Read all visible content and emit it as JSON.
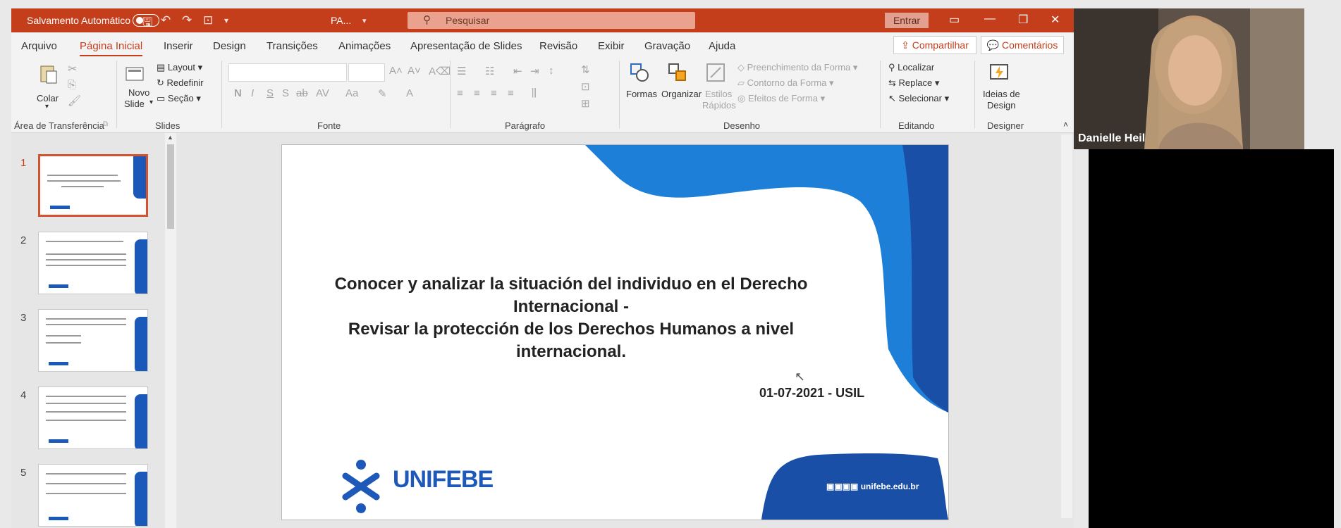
{
  "titlebar": {
    "autosave_label": "Salvamento Automático",
    "doc_name": "PA...",
    "search_placeholder": "Pesquisar",
    "signin_label": "Entrar"
  },
  "tabs": [
    "Arquivo",
    "Página Inicial",
    "Inserir",
    "Design",
    "Transições",
    "Animações",
    "Apresentação de Slides",
    "Revisão",
    "Exibir",
    "Gravação",
    "Ajuda"
  ],
  "active_tab": "Página Inicial",
  "share_label": "Compartilhar",
  "comments_label": "Comentários",
  "ribbon": {
    "paste": "Colar",
    "layout": "Layout",
    "reset": "Redefinir",
    "new_slide_1": "Novo",
    "new_slide_2": "Slide",
    "section": "Seção",
    "shapes": "Formas",
    "arrange": "Organizar",
    "styles_1": "Estilos",
    "styles_2": "Rápidos",
    "fill": "Preenchimento da Forma",
    "outline": "Contorno da Forma",
    "effects": "Efeitos de Forma",
    "find": "Localizar",
    "replace": "Replace",
    "select": "Selecionar",
    "ideas_1": "Ideias de",
    "ideas_2": "Design",
    "groups": {
      "clipboard": "Área de Transferência",
      "slides": "Slides",
      "font": "Fonte",
      "paragraph": "Parágrafo",
      "drawing": "Desenho",
      "editing": "Editando",
      "designer": "Designer"
    }
  },
  "thumbnails": [
    "1",
    "2",
    "3",
    "4",
    "5"
  ],
  "slide": {
    "title_line1": "Conocer y analizar la situación del individuo en el Derecho",
    "title_line2": "Internacional -",
    "title_line3": "Revisar la protección de los Derechos Humanos a nivel",
    "title_line4": "internacional.",
    "subtitle": "01-07-2021 - USIL",
    "logo_text": "UNIFEBE",
    "url": "unifebe.edu.br"
  },
  "webcam": {
    "name": "Danielle Heil"
  },
  "colors": {
    "accent": "#c43e1c",
    "brand_blue": "#1e58b8"
  }
}
